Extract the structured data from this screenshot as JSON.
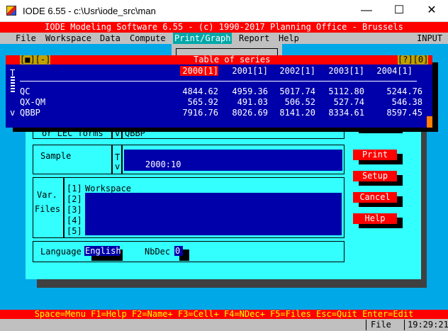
{
  "window": {
    "title": "IODE 6.55 - c:\\Usr\\iode_src\\man",
    "minimize": "—",
    "maximize": "☐",
    "close": "✕"
  },
  "banner": "IODE Modeling Software 6.55 - (c) 1990-2017 Planning Office - Brussels",
  "menu": {
    "items": [
      "File",
      "Workspace",
      "Data",
      "Compute",
      "Print/Graph",
      "Report",
      "Help"
    ],
    "mode": "INPUT"
  },
  "table": {
    "left_controls": "[■][-]",
    "title": "Table of series",
    "right_controls": "[?][0]",
    "columns": [
      "2000[1]",
      "2001[1]",
      "2002[1]",
      "2003[1]",
      "2004[1]"
    ],
    "side_marks": [
      "T",
      "v"
    ],
    "rows": [
      {
        "name": "QC",
        "values": [
          "4844.62",
          "4959.36",
          "5017.74",
          "5112.80",
          "5244.76"
        ]
      },
      {
        "name": "QX-QM",
        "values": [
          "565.92",
          "491.03",
          "506.52",
          "527.74",
          "546.38"
        ]
      },
      {
        "name": "QBBP",
        "values": [
          "7916.76",
          "8026.69",
          "8141.20",
          "8334.61",
          "8597.45"
        ]
      }
    ]
  },
  "dialog": {
    "lec_label": "or LEC forms",
    "lec_flag": "v",
    "lec_value": "QBBP",
    "sample_label": "Sample",
    "sample_flags": [
      "T",
      "v"
    ],
    "sample_value": "2000:10",
    "files_label_1": "Var.",
    "files_label_2": "Files",
    "file_slots": [
      "[1]",
      "[2]",
      "[3]",
      "[4]",
      "[5]"
    ],
    "file_1": "Workspace",
    "language_label": "Language",
    "language_value": "English",
    "nbdec_label": "NbDec",
    "nbdec_value": "0",
    "buttons": {
      "print": "Print",
      "setup": "Setup",
      "cancel": "Cancel",
      "help": "Help"
    }
  },
  "helpbar": "Space=Menu F1=Help F2=Name+ F3=Cell+ F4=NDec+ F5=Files Esc=Quit Enter=Edit",
  "status": {
    "mode": "File",
    "time": "19:29:21"
  },
  "colors": {
    "red": "#ff0000",
    "navy": "#0000aa",
    "cyan": "#33ffff",
    "menu_grey": "#c0c0c0",
    "desktop": "#00a8e8"
  }
}
